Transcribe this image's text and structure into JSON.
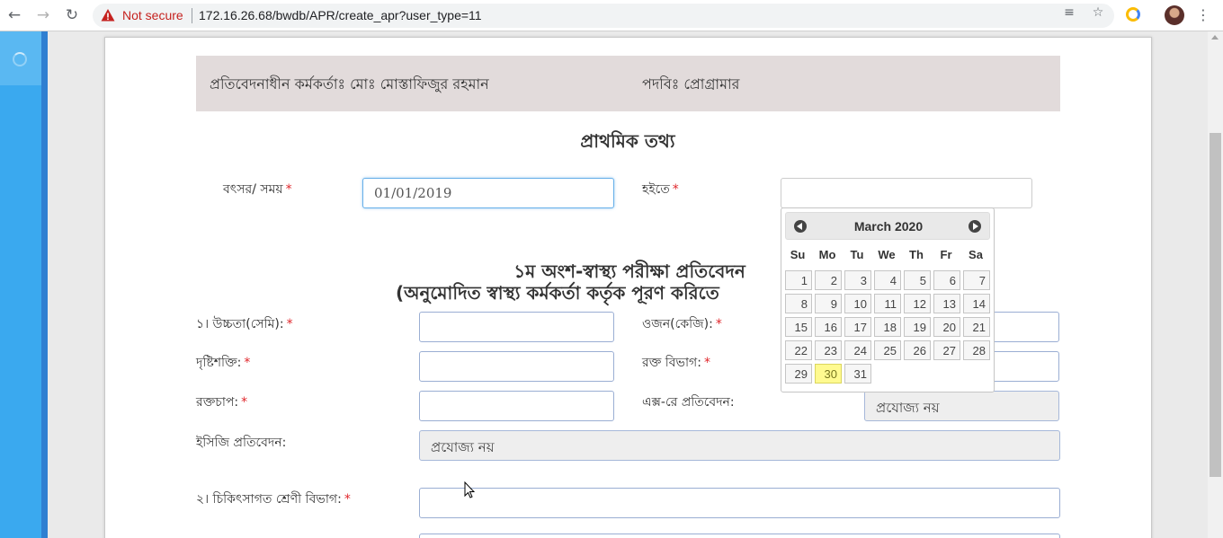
{
  "browser": {
    "security_label": "Not secure",
    "url": "172.16.26.68/bwdb/APR/create_apr?user_type=11"
  },
  "info": {
    "officer_label": "প্রতিবেদনাধীন কর্মকর্তাঃ মোঃ মোস্তাফিজুর রহমান",
    "designation_label": "পদবিঃ প্রোগ্রামার"
  },
  "section1": {
    "title": "প্রাথমিক তথ্য",
    "year_label": "বৎসর/ সময়",
    "year_value": "01/01/2019",
    "from_label": "হইতে",
    "from_value": ""
  },
  "section2": {
    "title_line1": "১ম অংশ-স্বাস্থ্য পরীক্ষা প্রতিবেদন",
    "title_line2": "(অনুমোদিত স্বাস্থ্য কর্মকর্তা কর্তৃক পূরণ করিতে",
    "height_label": "১। উচ্চতা(সেমি):",
    "weight_label": "ওজন(কেজি):",
    "eyesight_label": "দৃষ্টিশক্তি:",
    "blood_group_label": "রক্ত বিভাগ:",
    "blood_pressure_label": "রক্তচাপ:",
    "xray_label": "এক্স-রে প্রতিবেদন:",
    "xray_value": "প্রযোজ্য নয়",
    "ecg_label": "ইসিজি প্রতিবেদন:",
    "ecg_value": "প্রযোজ্য নয়",
    "medical_class_label": "২। চিকিৎসাগত শ্রেণী বিভাগ:"
  },
  "required_mark": "*",
  "datepicker": {
    "month_label": "March 2020",
    "weekdays": [
      "Su",
      "Mo",
      "Tu",
      "We",
      "Th",
      "Fr",
      "Sa"
    ],
    "days": [
      "1",
      "2",
      "3",
      "4",
      "5",
      "6",
      "7",
      "8",
      "9",
      "10",
      "11",
      "12",
      "13",
      "14",
      "15",
      "16",
      "17",
      "18",
      "19",
      "20",
      "21",
      "22",
      "23",
      "24",
      "25",
      "26",
      "27",
      "28",
      "29",
      "30",
      "31"
    ],
    "today": "30"
  },
  "colors": {
    "sidebar": "#3aa9ef",
    "info_bar": "#e2dbdb",
    "required": "#e0262b",
    "today_highlight": "#fffa90"
  }
}
